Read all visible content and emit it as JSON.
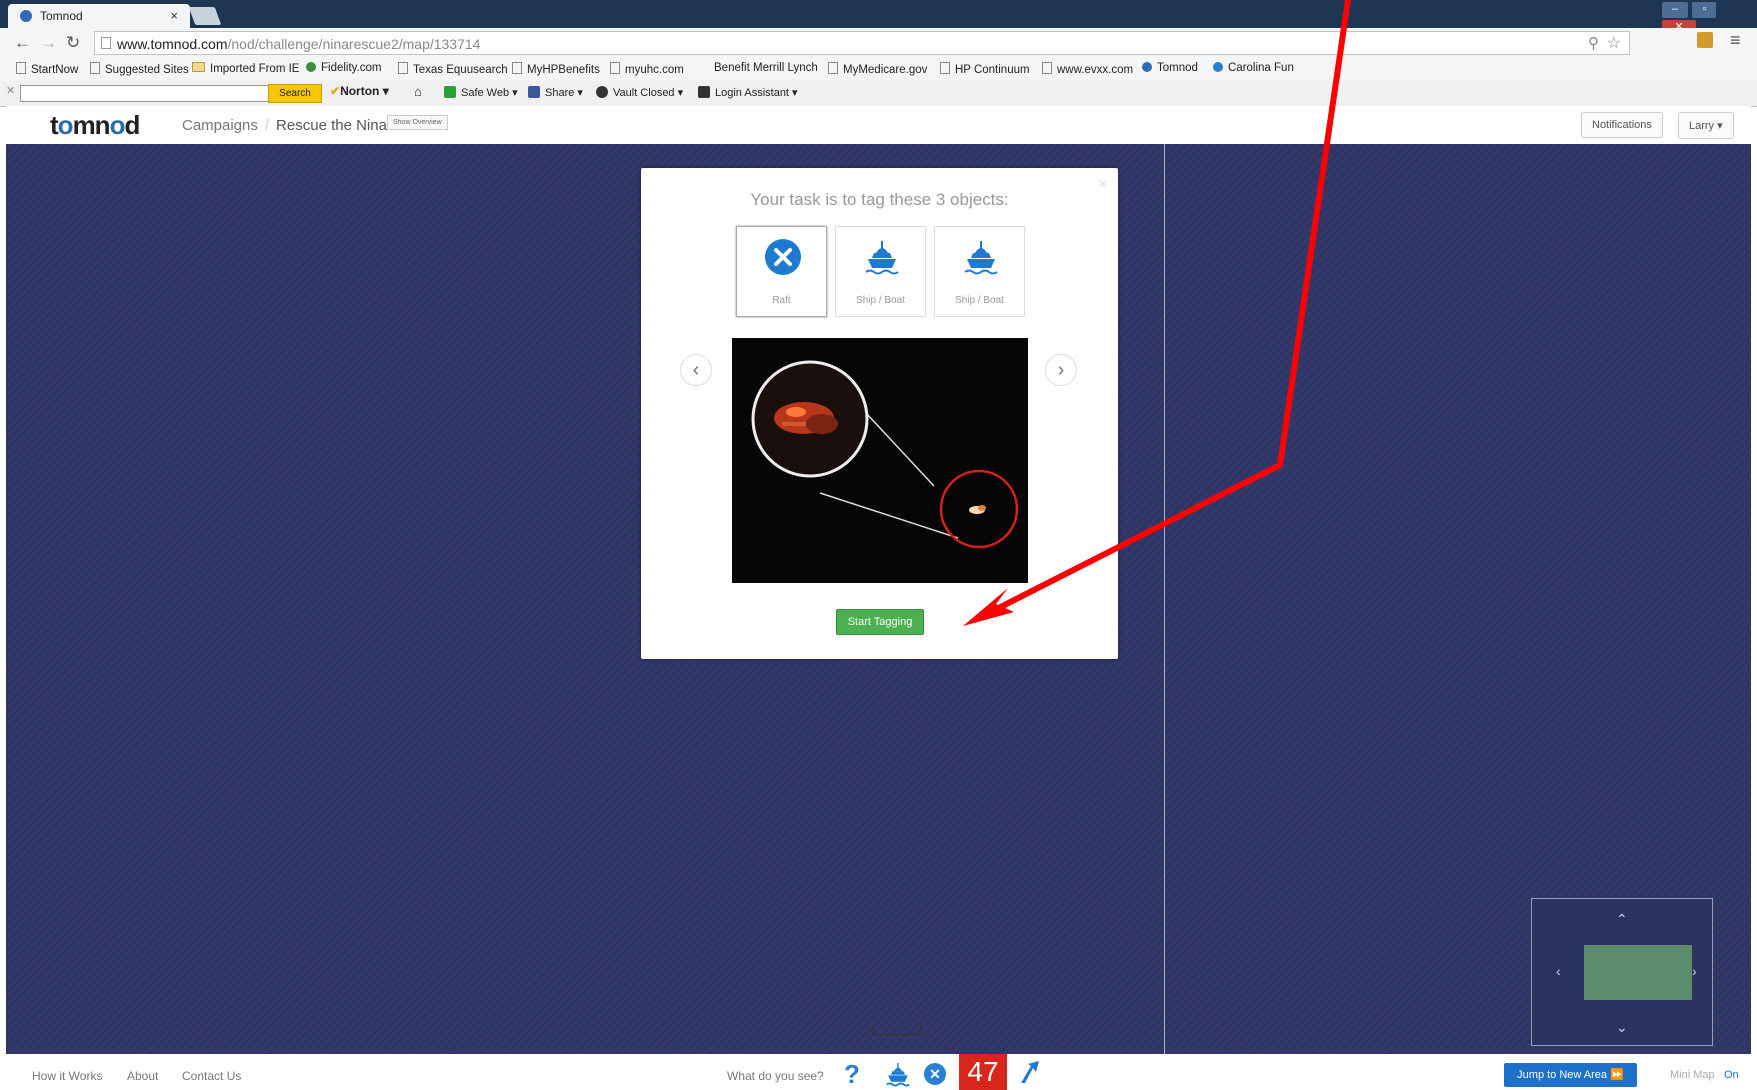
{
  "browser": {
    "tab_title": "Tomnod",
    "tab_close": "×",
    "url_host": "www.tomnod.com",
    "url_path": "/nod/challenge/ninarescue2/map/133714"
  },
  "bookmarks": [
    "StartNow",
    "Suggested Sites",
    "Imported From IE",
    "Fidelity.com",
    "Texas Equusearch",
    "MyHPBenefits",
    "myuhc.com",
    "Benefit Merrill Lynch",
    "MyMedicare.gov",
    "HP Continuum",
    "www.evxx.com",
    "Tomnod",
    "Carolina Fun"
  ],
  "norton": {
    "search_label": "Search",
    "norton_label": "Norton",
    "safe_web": "Safe Web",
    "share": "Share",
    "vault": "Vault Closed",
    "login": "Login Assistant"
  },
  "site": {
    "logo": "tomnod",
    "crumb_campaigns": "Campaigns",
    "crumb_sep": "/",
    "crumb_current": "Rescue the Nina",
    "overview_button": "Show Overview",
    "notifications": "Notifications",
    "user": "Larry"
  },
  "modal": {
    "title": "Your task is to tag these 3 objects:",
    "close": "×",
    "objects": [
      {
        "label": "Raft",
        "icon": "x-circle-icon"
      },
      {
        "label": "Ship / Boat",
        "icon": "ship-icon"
      },
      {
        "label": "Ship / Boat",
        "icon": "ship-icon"
      }
    ],
    "prev": "‹",
    "next": "›",
    "start_button": "Start Tagging"
  },
  "footer": {
    "how": "How it Works",
    "about": "About",
    "contact": "Contact Us",
    "prompt": "What do you see?",
    "count": "47",
    "jump_button": "Jump to New Area",
    "minimap_label": "Mini Map",
    "minimap_state": "On"
  },
  "colors": {
    "accent_blue": "#2a7fd4",
    "count_red": "#d9261c",
    "start_green": "#4caf50",
    "annotation_arrow": "#ff0000"
  }
}
